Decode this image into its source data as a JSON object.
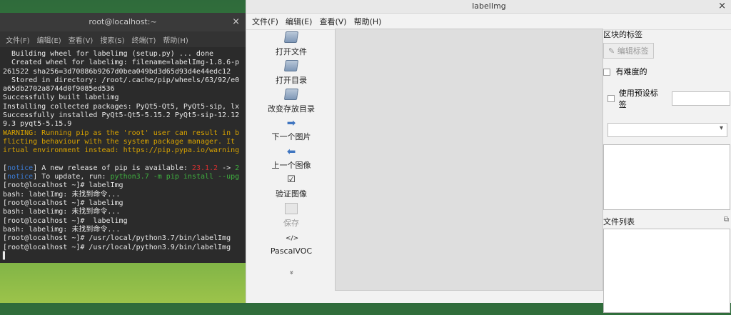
{
  "terminal": {
    "title": "root@localhost:~",
    "close": "×",
    "menu": [
      "文件(F)",
      "编辑(E)",
      "查看(V)",
      "搜索(S)",
      "终端(T)",
      "帮助(H)"
    ],
    "lines": [
      {
        "t": "  Building wheel for labelimg (setup.py) ... done",
        "c": ""
      },
      {
        "t": "  Created wheel for labelimg: filename=labelImg-1.8.6-p",
        "c": ""
      },
      {
        "t": "261522 sha256=3d70886b9267d0bea049bd3d65d93d4e44edc12",
        "c": ""
      },
      {
        "t": "  Stored in directory: /root/.cache/pip/wheels/63/92/e0",
        "c": ""
      },
      {
        "t": "a65db2702a8744d0f9085ed536",
        "c": ""
      },
      {
        "t": "Successfully built labelimg",
        "c": ""
      },
      {
        "t": "Installing collected packages: PyQt5-Qt5, PyQt5-sip, lx",
        "c": ""
      },
      {
        "t": "Successfully installed PyQt5-Qt5-5.15.2 PyQt5-sip-12.12",
        "c": ""
      },
      {
        "t": "9.3 pyqt5-5.15.9",
        "c": ""
      },
      {
        "t": "WARNING: Running pip as the 'root' user can result in b",
        "c": "w"
      },
      {
        "t": "flicting behaviour with the system package manager. It",
        "c": "w"
      },
      {
        "t": "irtual environment instead: https://pip.pypa.io/warning",
        "c": "w"
      },
      {
        "t": "",
        "c": ""
      },
      {
        "t": "[notice] A new release of pip is available: 23.1.2 -> 2",
        "c": "notice1"
      },
      {
        "t": "[notice] To update, run: python3.7 -m pip install --upg",
        "c": "notice2"
      },
      {
        "t": "[root@localhost ~]# labelImg",
        "c": ""
      },
      {
        "t": "bash: labelImg: 未找到命令...",
        "c": ""
      },
      {
        "t": "[root@localhost ~]# labelimg",
        "c": ""
      },
      {
        "t": "bash: labelimg: 未找到命令...",
        "c": ""
      },
      {
        "t": "[root@localhost ~]#  labelimg",
        "c": ""
      },
      {
        "t": "bash: labelimg: 未找到命令...",
        "c": ""
      },
      {
        "t": "[root@localhost ~]# /usr/local/python3.7/bin/labelImg",
        "c": ""
      },
      {
        "t": "[root@localhost ~]# /usr/local/python3.9/bin/labelImg",
        "c": ""
      },
      {
        "t": "▌",
        "c": ""
      }
    ]
  },
  "window": {
    "title": "labelImg",
    "close": "×",
    "menu": [
      "文件(F)",
      "编辑(E)",
      "查看(V)",
      "帮助(H)"
    ],
    "tools": [
      {
        "label": "打开文件",
        "icon": "folder-icon",
        "disabled": false
      },
      {
        "label": "打开目录",
        "icon": "folder-icon",
        "disabled": false
      },
      {
        "label": "改变存放目录",
        "icon": "folder-icon",
        "disabled": false
      },
      {
        "label": "下一个图片",
        "icon": "arrow-right-icon",
        "disabled": false
      },
      {
        "label": "上一个图像",
        "icon": "arrow-left-icon",
        "disabled": false
      },
      {
        "label": "验证图像",
        "icon": "checkbox-icon",
        "disabled": false
      },
      {
        "label": "保存",
        "icon": "save-icon",
        "disabled": true
      },
      {
        "label": "PascalVOC",
        "icon": "code-icon",
        "disabled": false
      }
    ],
    "more": "»",
    "right": {
      "block_label_title": "区块的标签",
      "edit_label_btn": "编辑标签",
      "difficult_label": "有难度的",
      "use_default_label": "使用预设标签",
      "file_list_title": "文件列表"
    }
  }
}
